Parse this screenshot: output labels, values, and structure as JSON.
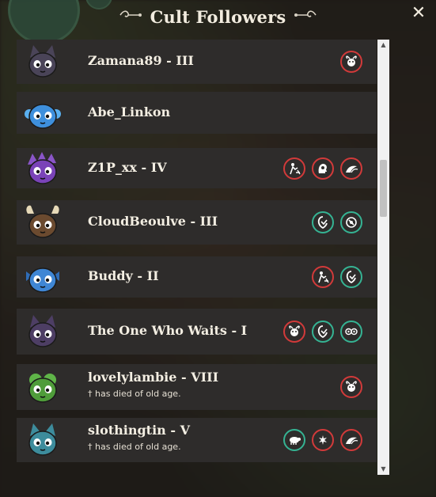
{
  "dialog": {
    "title": "Cult Followers",
    "close_label": "✕"
  },
  "followers": [
    {
      "name": "Zamana89 - III",
      "status": "",
      "avatar": "cat-grey-avatar",
      "traits": [
        {
          "icon": "bull-face-icon",
          "color": "red"
        }
      ]
    },
    {
      "name": "Abe_Linkon",
      "status": "",
      "avatar": "monkey-blue-avatar",
      "traits": []
    },
    {
      "name": "Z1P_xx - IV",
      "status": "",
      "avatar": "hedgehog-purple-avatar",
      "traits": [
        {
          "icon": "worker-icon",
          "color": "red"
        },
        {
          "icon": "mind-icon",
          "color": "red"
        },
        {
          "icon": "wings-icon",
          "color": "red"
        }
      ]
    },
    {
      "name": "CloudBeoulve - III",
      "status": "",
      "avatar": "bison-brown-avatar",
      "traits": [
        {
          "icon": "faith-icon",
          "color": "green"
        },
        {
          "icon": "no-food-icon",
          "color": "green"
        }
      ]
    },
    {
      "name": "Buddy - II",
      "status": "",
      "avatar": "axolotl-blue-avatar",
      "traits": [
        {
          "icon": "worker-icon",
          "color": "red"
        },
        {
          "icon": "faith-icon",
          "color": "green"
        }
      ]
    },
    {
      "name": "The One Who Waits - I",
      "status": "",
      "avatar": "horned-purple-avatar",
      "traits": [
        {
          "icon": "bull-face-icon",
          "color": "red"
        },
        {
          "icon": "faith-icon",
          "color": "green"
        },
        {
          "icon": "eyes-icon",
          "color": "green"
        }
      ]
    },
    {
      "name": "lovelylambie - VIII",
      "status": "† has died of old age.",
      "avatar": "frog-green-avatar",
      "traits": [
        {
          "icon": "bull-face-icon",
          "color": "red"
        }
      ]
    },
    {
      "name": "slothingtin - V",
      "status": "† has died of old age.",
      "avatar": "cat-teal-avatar",
      "traits": [
        {
          "icon": "sheep-icon",
          "color": "green"
        },
        {
          "icon": "spark-icon",
          "color": "red"
        },
        {
          "icon": "wings-icon",
          "color": "red"
        }
      ]
    }
  ],
  "colors": {
    "red": "#d23a3a",
    "green": "#35b393",
    "row_bg": "#2e2c2b"
  }
}
